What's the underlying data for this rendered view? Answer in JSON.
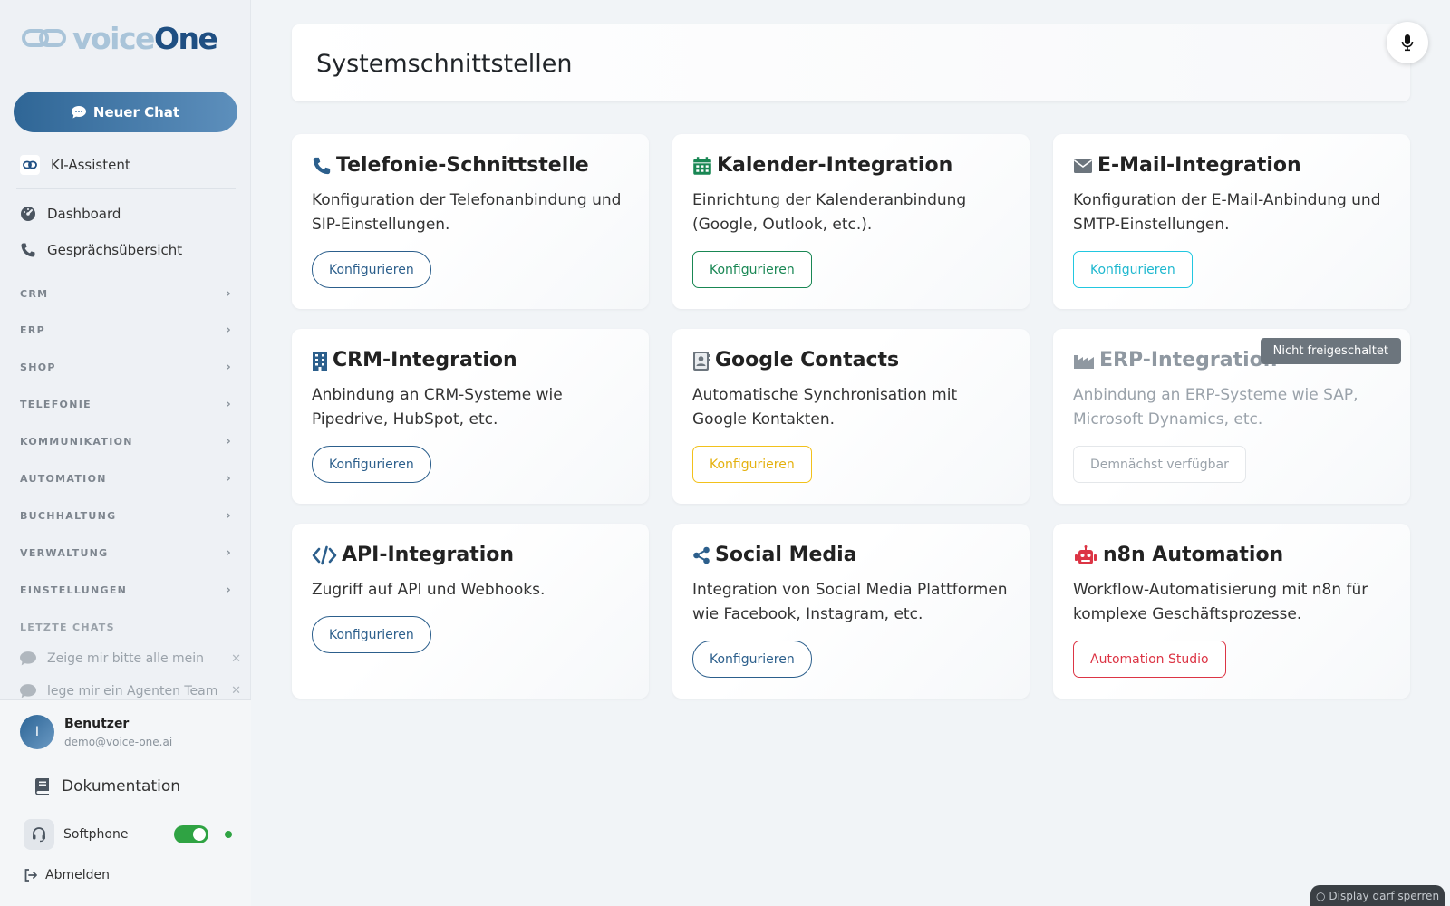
{
  "app": {
    "logo_voice": "voice",
    "logo_one": "One",
    "brand_color": "#1f4f82"
  },
  "sidebar": {
    "new_chat_label": "Neuer Chat",
    "ki_assistant": "KI-Assistent",
    "nav": [
      {
        "label": "Dashboard",
        "icon": "gauge-icon"
      },
      {
        "label": "Gesprächsübersicht",
        "icon": "phone-icon"
      }
    ],
    "sections": [
      "CRM",
      "ERP",
      "SHOP",
      "TELEFONIE",
      "KOMMUNIKATION",
      "AUTOMATION",
      "BUCHHALTUNG",
      "VERWALTUNG",
      "EINSTELLUNGEN"
    ],
    "recent_title": "LETZTE CHATS",
    "recent_chats": [
      "Zeige mir bitte alle mein",
      "lege mir ein Agenten Team"
    ],
    "user": {
      "initial": "I",
      "name": "Benutzer",
      "email": "demo@voice-one.ai"
    },
    "documentation": "Dokumentation",
    "softphone": {
      "label": "Softphone",
      "enabled": true
    },
    "logout": "Abmelden"
  },
  "main": {
    "page_title": "Systemschnittstellen",
    "cards": [
      {
        "title": "Telefonie-Schnittstelle",
        "description": "Konfiguration der Telefonanbindung und SIP-Einstellungen.",
        "button": "Konfigurieren",
        "icon": "phone-icon",
        "icon_color": "#2c5f8c"
      },
      {
        "title": "Kalender-Integration",
        "description": "Einrichtung der Kalenderanbindung (Google, Outlook, etc.).",
        "button": "Konfigurieren",
        "icon": "calendar-icon",
        "icon_color": "#198754"
      },
      {
        "title": "E-Mail-Integration",
        "description": "Konfiguration der E-Mail-Anbindung und SMTP-Einstellungen.",
        "button": "Konfigurieren",
        "icon": "envelope-icon",
        "icon_color": "#6c757d"
      },
      {
        "title": "CRM-Integration",
        "description": "Anbindung an CRM-Systeme wie Pipedrive, HubSpot, etc.",
        "button": "Konfigurieren",
        "icon": "building-icon",
        "icon_color": "#2c5f8c"
      },
      {
        "title": "Google Contacts",
        "description": "Automatische Synchronisation mit Google Kontakten.",
        "button": "Konfigurieren",
        "icon": "contact-card-icon",
        "icon_color": "#6c757d"
      },
      {
        "title": "ERP-Integration",
        "description": "Anbindung an ERP-Systeme wie SAP, Microsoft Dynamics, etc.",
        "button": "Demnächst verfügbar",
        "badge": "Nicht freigeschaltet",
        "icon": "factory-icon",
        "icon_color": "#9aa2aa"
      },
      {
        "title": "API-Integration",
        "description": "Zugriff auf API und Webhooks.",
        "button": "Konfigurieren",
        "icon": "code-icon",
        "icon_color": "#2c5f8c"
      },
      {
        "title": "Social Media",
        "description": "Integration von Social Media Plattformen wie Facebook, Instagram, etc.",
        "button": "Konfigurieren",
        "icon": "share-icon",
        "icon_color": "#2c5f8c"
      },
      {
        "title": "n8n Automation",
        "description": "Workflow-Automatisierung mit n8n für komplexe Geschäftsprozesse.",
        "button": "Automation Studio",
        "icon": "robot-icon",
        "icon_color": "#dc3545"
      }
    ]
  },
  "status_pill": "Display darf sperren"
}
